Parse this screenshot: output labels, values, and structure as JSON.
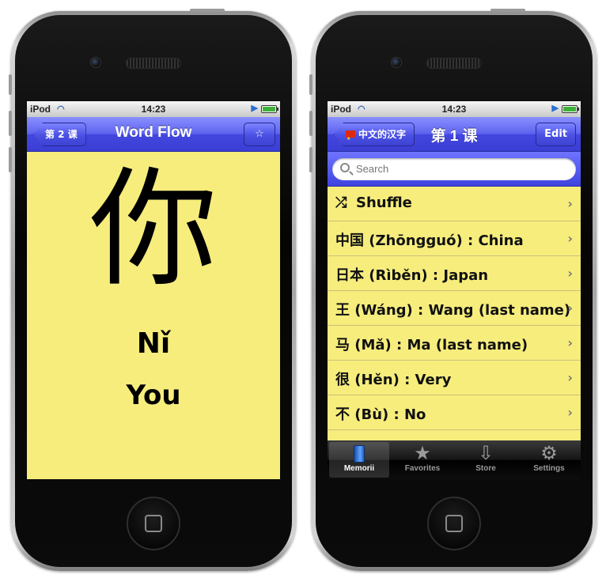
{
  "left_phone": {
    "status": {
      "carrier": "iPod",
      "time": "14:23"
    },
    "nav": {
      "back_label": "第 2 课",
      "title": "Word Flow",
      "star_label": "☆"
    },
    "card": {
      "hanzi": "你",
      "pinyin": "Nǐ",
      "meaning": "You"
    }
  },
  "right_phone": {
    "status": {
      "carrier": "iPod",
      "time": "14:23"
    },
    "nav": {
      "back_label": "中文的汉字",
      "title": "第 1 课",
      "edit_label": "Edit"
    },
    "search": {
      "placeholder": "Search"
    },
    "list": [
      {
        "label": "Shuffle",
        "icon": "shuffle-icon"
      },
      {
        "label": "中国 (Zhōngguó) : China"
      },
      {
        "label": "日本 (Rìběn) : Japan"
      },
      {
        "label": "王 (Wáng) : Wang (last name)"
      },
      {
        "label": "马 (Mǎ) : Ma (last name)"
      },
      {
        "label": "很 (Hěn) : Very"
      },
      {
        "label": "不 (Bù) : No"
      }
    ],
    "tabs": [
      {
        "label": "Memorii",
        "icon": "book-icon",
        "active": true
      },
      {
        "label": "Favorites",
        "icon": "star-icon"
      },
      {
        "label": "Store",
        "icon": "download-icon"
      },
      {
        "label": "Settings",
        "icon": "gear-icon"
      }
    ]
  },
  "colors": {
    "nav_blue": "#4347df",
    "card_yellow": "#f6ed7d"
  }
}
